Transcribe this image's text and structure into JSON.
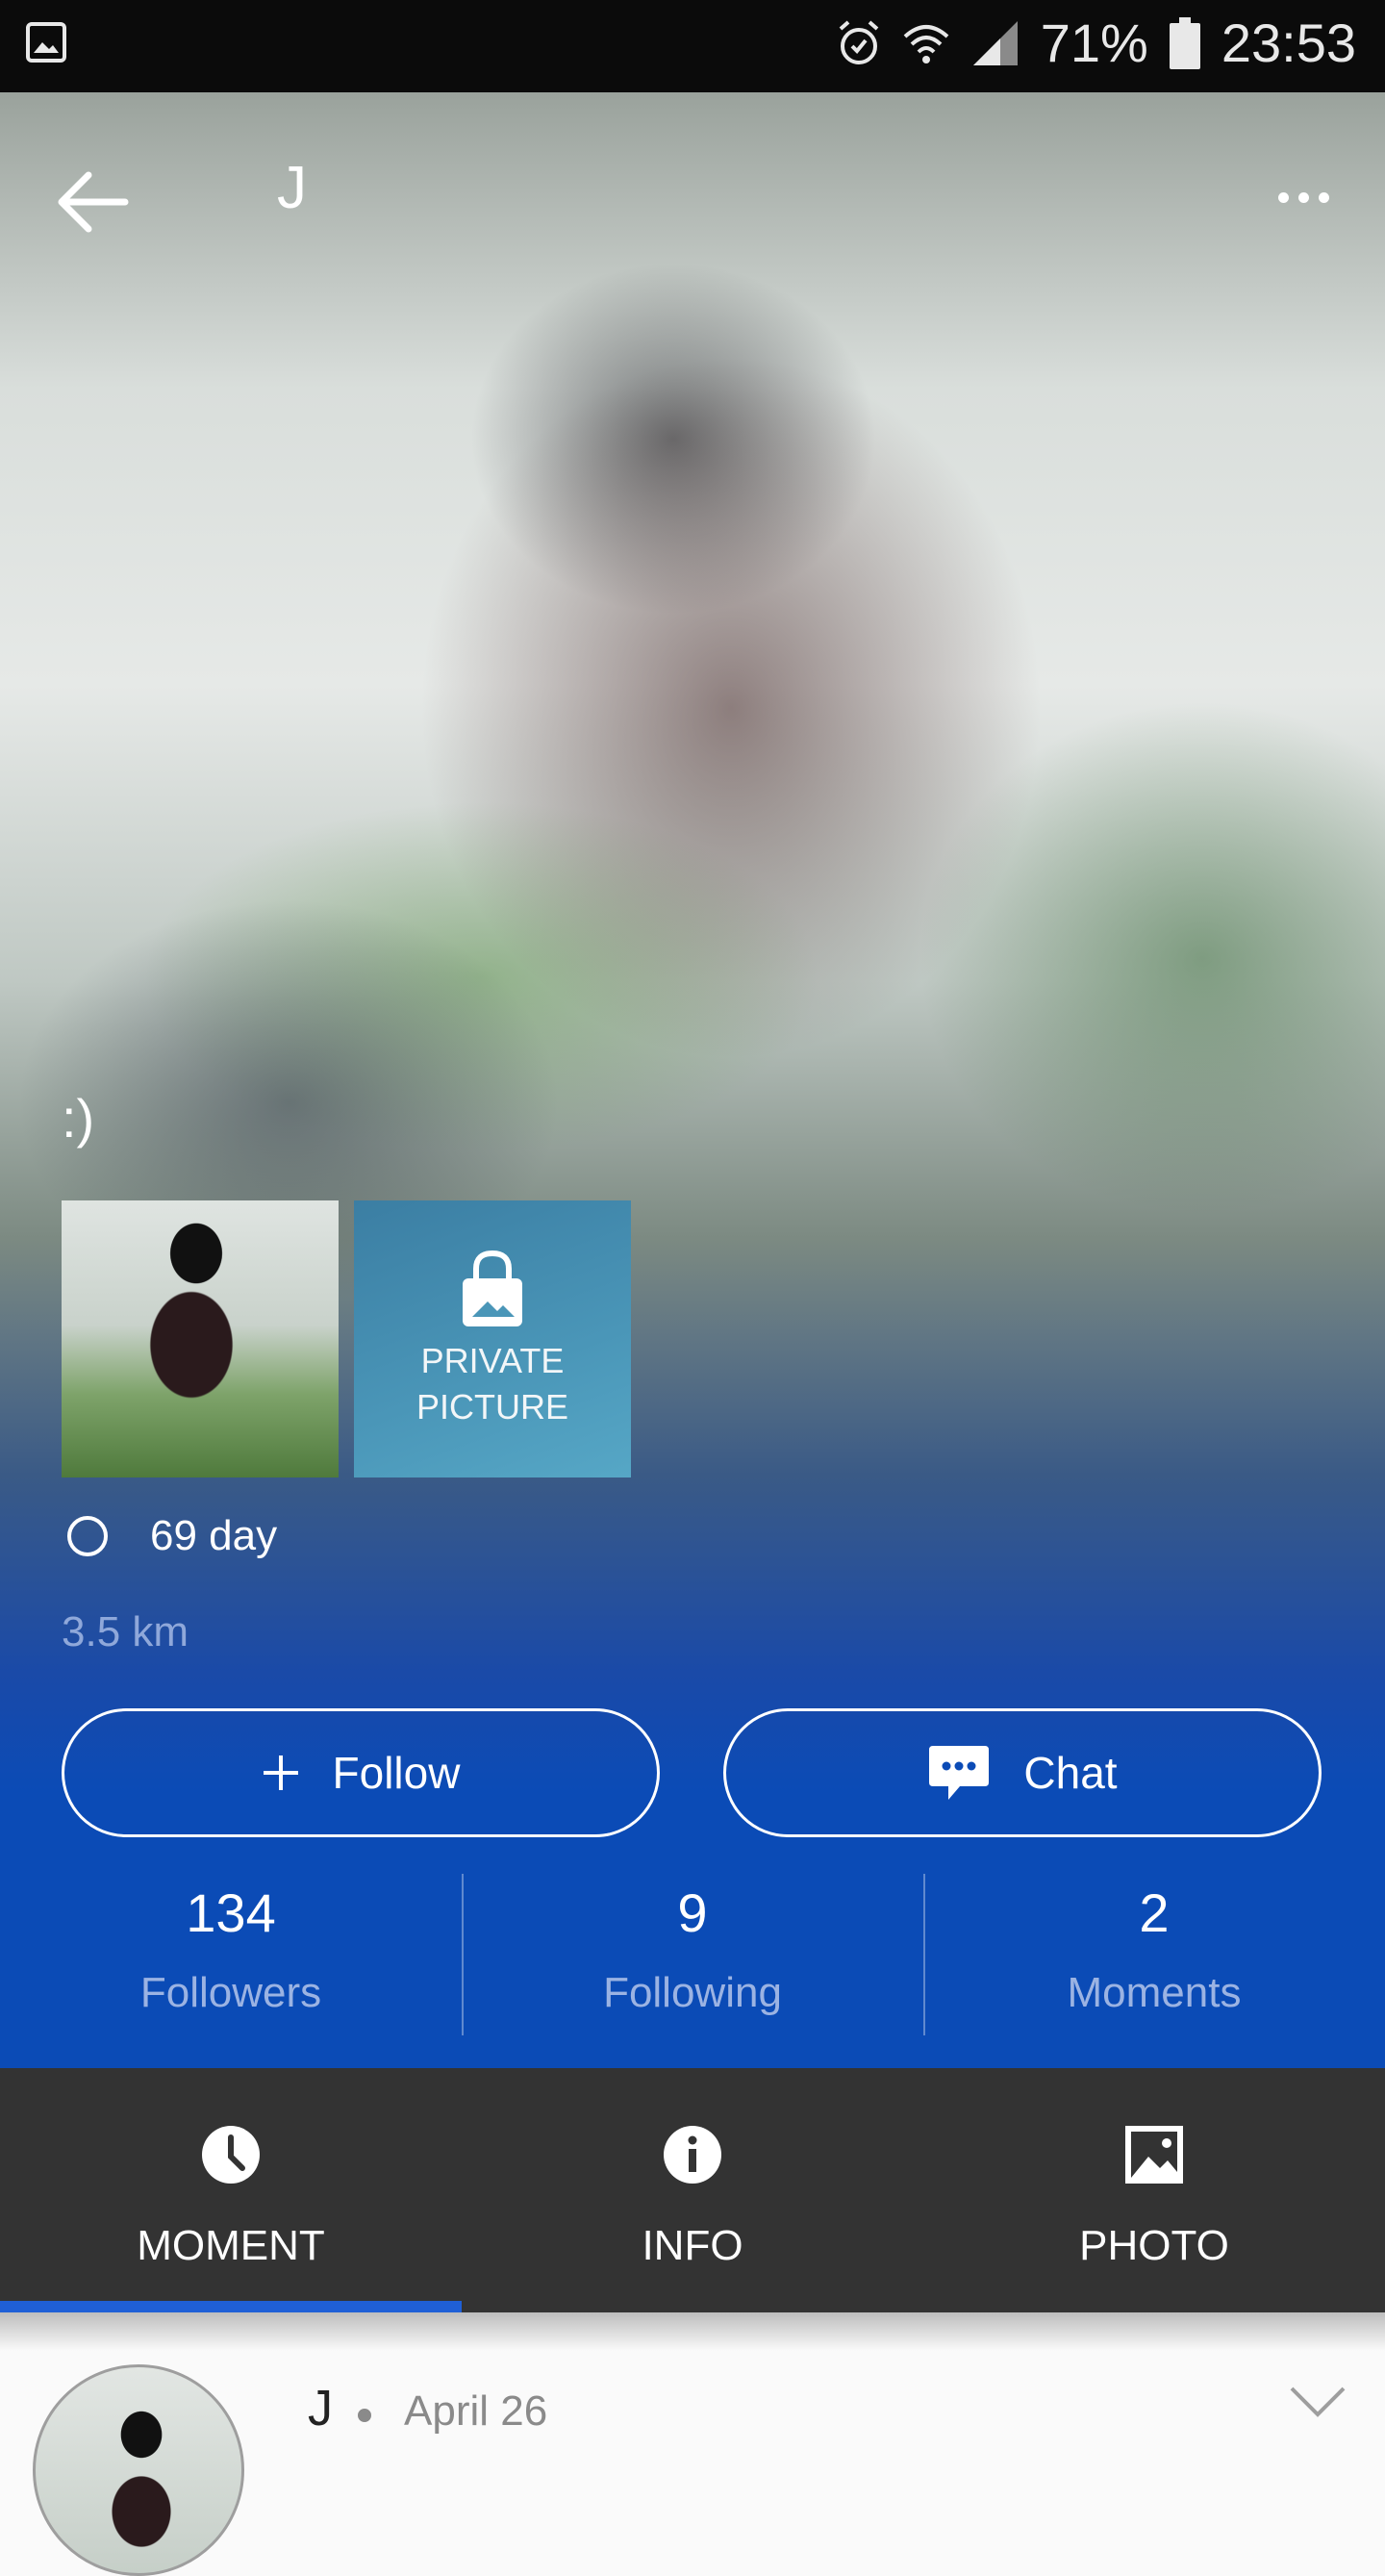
{
  "status_bar": {
    "battery": "71%",
    "time": "23:53",
    "icons": [
      "gallery-icon",
      "alarm-icon",
      "wifi-icon",
      "signal-icon",
      "battery-icon"
    ]
  },
  "header": {
    "title": "J",
    "icons": [
      "back-arrow-icon",
      "more-dots-icon"
    ]
  },
  "profile": {
    "status_text": ":)",
    "private_picture": "PRIVATE\nPICTURE",
    "days": "69 day",
    "distance": "3.5 km"
  },
  "actions": {
    "follow_label": "Follow",
    "chat_label": "Chat"
  },
  "stats": [
    {
      "value": "134",
      "label": "Followers"
    },
    {
      "value": "9",
      "label": "Following"
    },
    {
      "value": "2",
      "label": "Moments"
    }
  ],
  "tabs": [
    {
      "label": "MOMENT",
      "icon": "clock-icon",
      "active": true
    },
    {
      "label": "INFO",
      "icon": "info-icon",
      "active": false
    },
    {
      "label": "PHOTO",
      "icon": "photo-icon",
      "active": false
    }
  ],
  "post": {
    "author": "J",
    "date": "April 26"
  },
  "colors": {
    "accent": "#0b4bb6",
    "tab_bar": "#333333",
    "tab_indicator": "#1f5fd6"
  }
}
